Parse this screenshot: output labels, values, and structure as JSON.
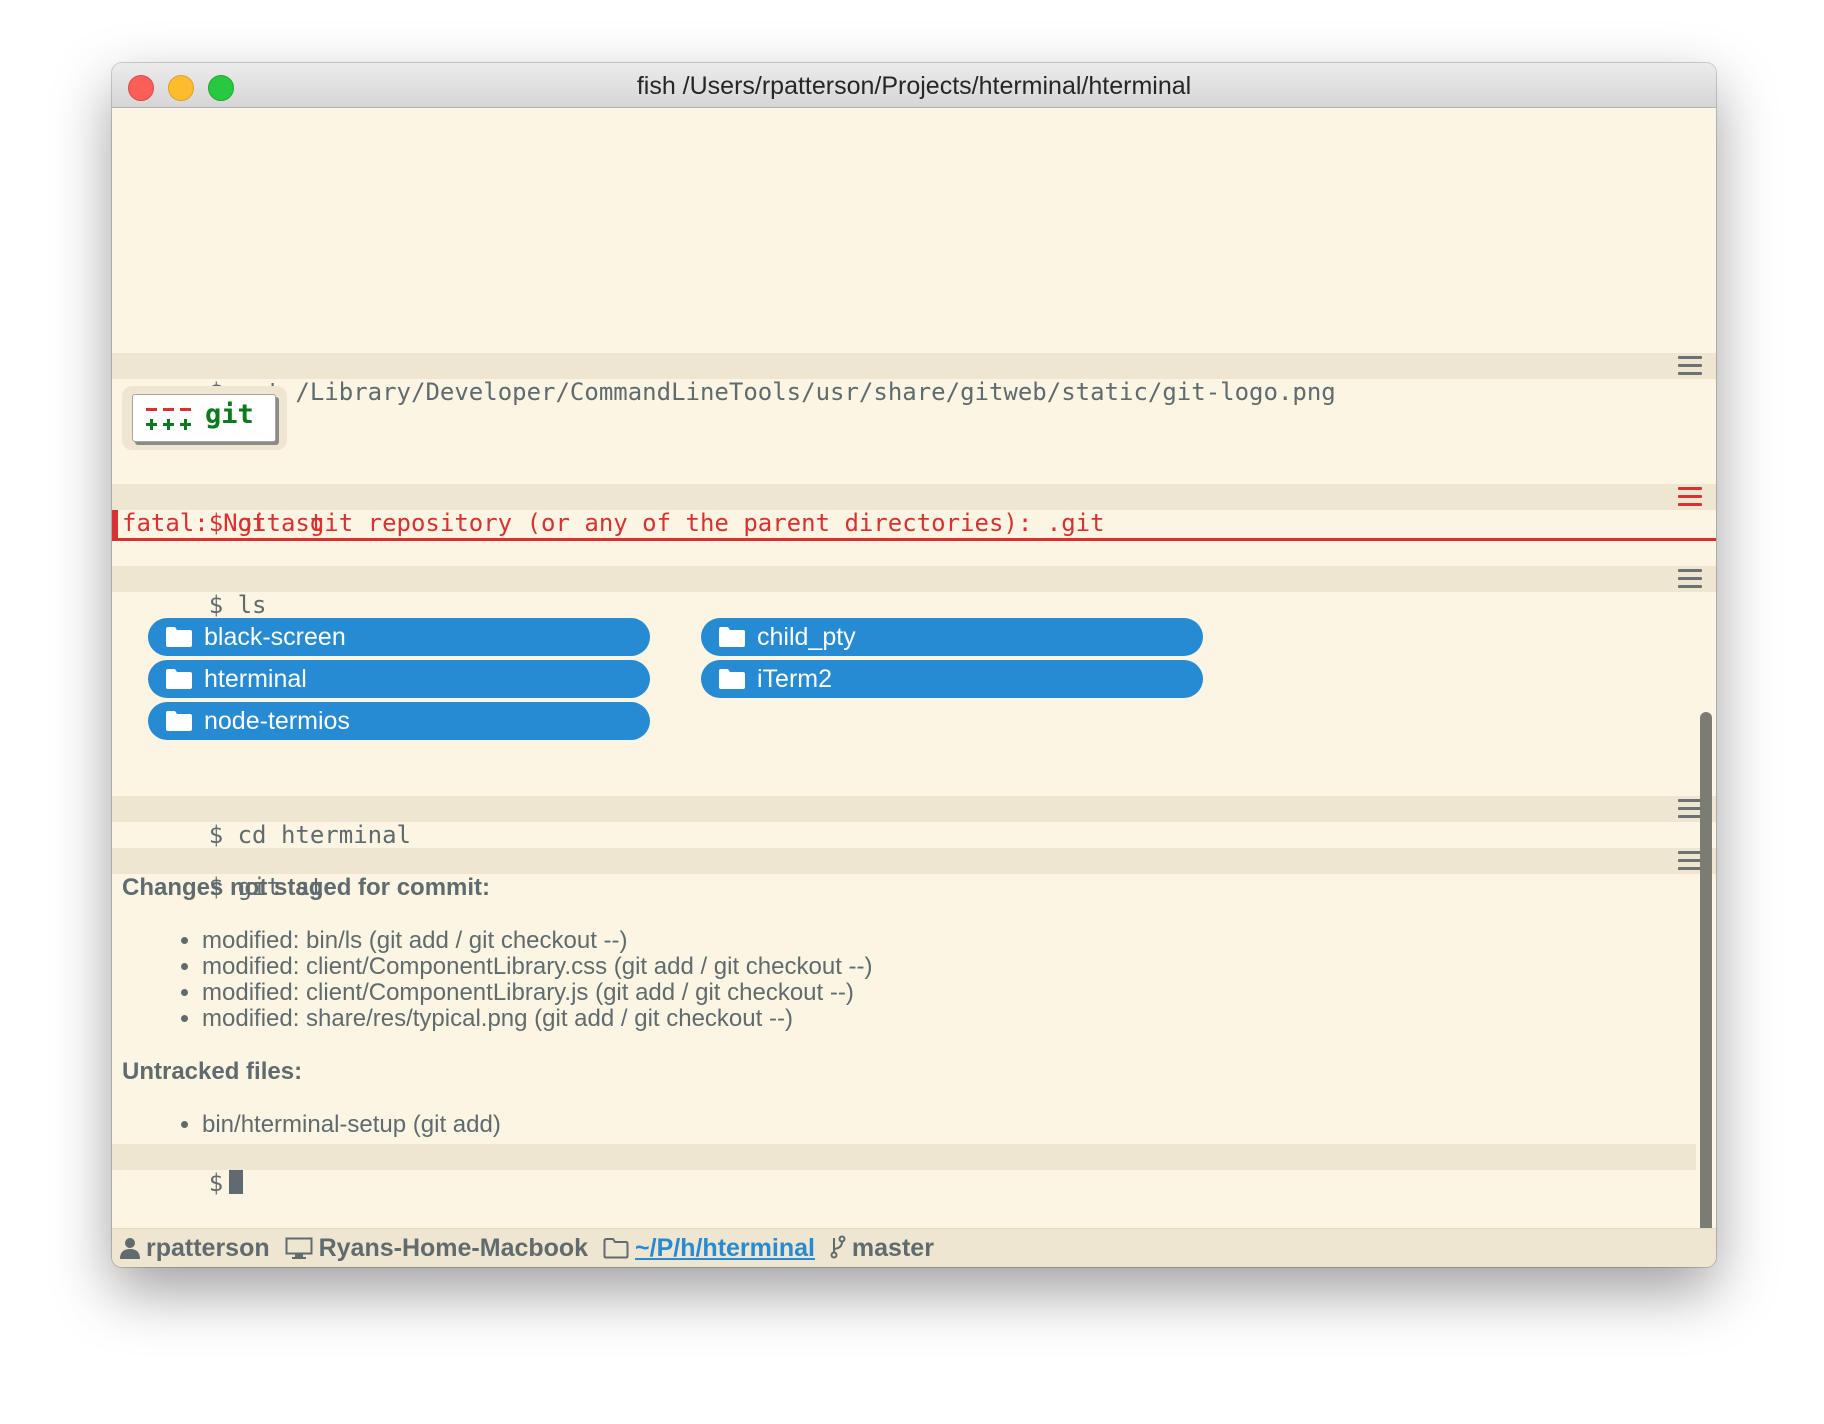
{
  "window": {
    "title": "fish /Users/rpatterson/Projects/hterminal/hterminal"
  },
  "blocks": {
    "cat": {
      "prompt": "$ cat /Library/Developer/CommandLineTools/usr/share/gitweb/static/git-logo.png",
      "image_text": "git"
    },
    "git_err": {
      "prompt": "$ git st",
      "error": "fatal: Not a git repository (or any of the parent directories): .git"
    },
    "ls": {
      "prompt": "$ ls",
      "folders": [
        "black-screen",
        "child_pty",
        "hterminal",
        "iTerm2",
        "node-termios"
      ]
    },
    "cd": {
      "prompt": "$ cd hterminal"
    },
    "git_st": {
      "prompt": "$ git st",
      "changes_heading": "Changes not staged for commit:",
      "changes": [
        "modified: bin/ls (git add / git checkout --)",
        "modified: client/ComponentLibrary.css (git add / git checkout --)",
        "modified: client/ComponentLibrary.js (git add / git checkout --)",
        "modified: share/res/typical.png (git add / git checkout --)"
      ],
      "untracked_heading": "Untracked files:",
      "untracked": [
        "bin/hterminal-setup (git add)"
      ]
    },
    "input": {
      "prompt": "$"
    }
  },
  "footer": {
    "user": "rpatterson",
    "host": "Ryans-Home-Macbook",
    "path": "~/P/h/hterminal",
    "branch": "master"
  },
  "colors": {
    "background": "#fcf5e3",
    "command_bar": "#efe6d1",
    "error": "#d93030",
    "folder": "#268bd2",
    "text": "#5f6b6e"
  },
  "icons": [
    "menu-icon",
    "folder-icon",
    "user-icon",
    "monitor-icon",
    "folder-outline-icon",
    "branch-icon"
  ]
}
